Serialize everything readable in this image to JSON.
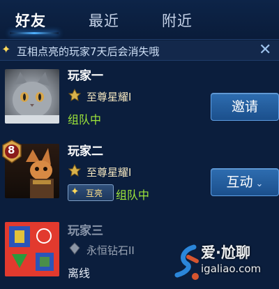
{
  "tabs": [
    {
      "label": "好友",
      "active": true
    },
    {
      "label": "最近",
      "active": false
    },
    {
      "label": "附近",
      "active": false
    }
  ],
  "notice": {
    "text": "互相点亮的玩家7天后会消失哦",
    "close_icon": "close-icon",
    "star_icon": "sparkle-icon"
  },
  "friends": [
    {
      "name": "玩家一",
      "rank": "至尊星耀I",
      "status": "组队中",
      "action": "邀请",
      "avatar": "gray-kitten-photo",
      "online": true
    },
    {
      "name": "玩家二",
      "rank": "至尊星耀I",
      "status": "组队中",
      "tag": "互亮",
      "action": "互动",
      "level_badge": "8",
      "avatar": "fox-hero-portrait",
      "online": true
    },
    {
      "name": "玩家三",
      "rank": "永恒钻石II",
      "status": "离线",
      "avatar": "colorful-shapes-avatar",
      "online": false
    }
  ],
  "watermark": {
    "title": "爱·尬聊",
    "url": "igaliao.com"
  },
  "colors": {
    "background": "#0b1e3d",
    "online_status": "#9ee63a",
    "button": "#2e6db0",
    "accent_glow": "#4fb0ff"
  }
}
